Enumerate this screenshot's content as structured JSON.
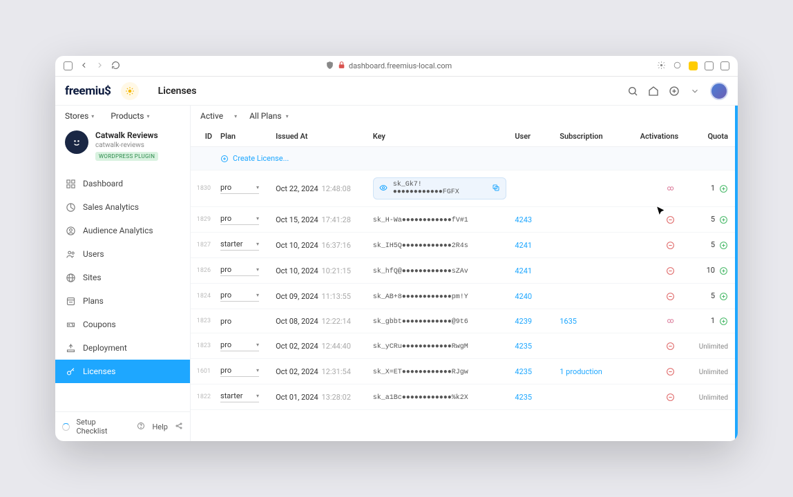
{
  "browser": {
    "url": "dashboard.freemius-local.com"
  },
  "header": {
    "logo": "freemiu$",
    "page_title": "Licenses"
  },
  "sidebar": {
    "top": {
      "stores": "Stores",
      "products": "Products"
    },
    "entity": {
      "name": "Catwalk Reviews",
      "slug": "catwalk-reviews",
      "badge": "WORDPRESS PLUGIN"
    },
    "nav": [
      {
        "label": "Dashboard",
        "icon": "dashboard"
      },
      {
        "label": "Sales Analytics",
        "icon": "chart"
      },
      {
        "label": "Audience Analytics",
        "icon": "audience"
      },
      {
        "label": "Users",
        "icon": "users"
      },
      {
        "label": "Sites",
        "icon": "globe"
      },
      {
        "label": "Plans",
        "icon": "plans"
      },
      {
        "label": "Coupons",
        "icon": "coupon"
      },
      {
        "label": "Deployment",
        "icon": "deploy"
      },
      {
        "label": "Licenses",
        "icon": "key",
        "active": true
      }
    ],
    "footer": {
      "setup": "Setup Checklist",
      "help": "Help"
    }
  },
  "filters": {
    "status": "Active",
    "plans": "All Plans"
  },
  "columns": {
    "id": "ID",
    "plan": "Plan",
    "issued": "Issued At",
    "key": "Key",
    "user": "User",
    "subscription": "Subscription",
    "activations": "Activations",
    "quota": "Quota"
  },
  "create_license": "Create License...",
  "rows": [
    {
      "id": "1830",
      "plan": "pro",
      "date": "Oct 22, 2024",
      "time": "12:48:08",
      "key": "sk_Gk7!●●●●●●●●●●●●FGFX",
      "user": "",
      "subs": "",
      "act_icon": "inf",
      "quota": "1",
      "highlight": true
    },
    {
      "id": "1829",
      "plan": "pro",
      "date": "Oct 15, 2024",
      "time": "17:41:28",
      "key": "sk_H-Wa●●●●●●●●●●●●fV#1",
      "user": "4243",
      "subs": "",
      "act_icon": "minus",
      "quota": "5"
    },
    {
      "id": "1827",
      "plan": "starter",
      "date": "Oct 10, 2024",
      "time": "16:37:16",
      "key": "sk_IH5Q●●●●●●●●●●●●2R4s",
      "user": "4241",
      "subs": "",
      "act_icon": "minus",
      "quota": "5"
    },
    {
      "id": "1826",
      "plan": "pro",
      "date": "Oct 10, 2024",
      "time": "10:21:15",
      "key": "sk_hfQ@●●●●●●●●●●●●sZAv",
      "user": "4241",
      "subs": "",
      "act_icon": "minus",
      "quota": "10"
    },
    {
      "id": "1824",
      "plan": "pro",
      "date": "Oct 09, 2024",
      "time": "11:13:55",
      "key": "sk_AB+8●●●●●●●●●●●●pm!Y",
      "user": "4240",
      "subs": "",
      "act_icon": "minus",
      "quota": "5"
    },
    {
      "id": "1823",
      "plan": "pro",
      "date": "Oct 08, 2024",
      "time": "12:22:14",
      "key": "sk_gbbt●●●●●●●●●●●●@9t6",
      "user": "4239",
      "subs": "1635",
      "act_icon": "inf",
      "quota": "1",
      "no_dropdown": true
    },
    {
      "id": "1823",
      "plan": "pro",
      "date": "Oct 02, 2024",
      "time": "12:44:40",
      "key": "sk_yCRu●●●●●●●●●●●●RwgM",
      "user": "4235",
      "subs": "",
      "act_icon": "minus",
      "quota": "Unlimited"
    },
    {
      "id": "1601",
      "plan": "pro",
      "date": "Oct 02, 2024",
      "time": "12:31:54",
      "key": "sk_X=ET●●●●●●●●●●●●RJgw",
      "user": "4235",
      "subs": "1 production",
      "act_icon": "minus",
      "quota": "Unlimited"
    },
    {
      "id": "1822",
      "plan": "starter",
      "date": "Oct 01, 2024",
      "time": "13:28:02",
      "key": "sk_a1Bc●●●●●●●●●●●●%k2X",
      "user": "4235",
      "subs": "",
      "act_icon": "minus",
      "quota": "Unlimited"
    }
  ]
}
